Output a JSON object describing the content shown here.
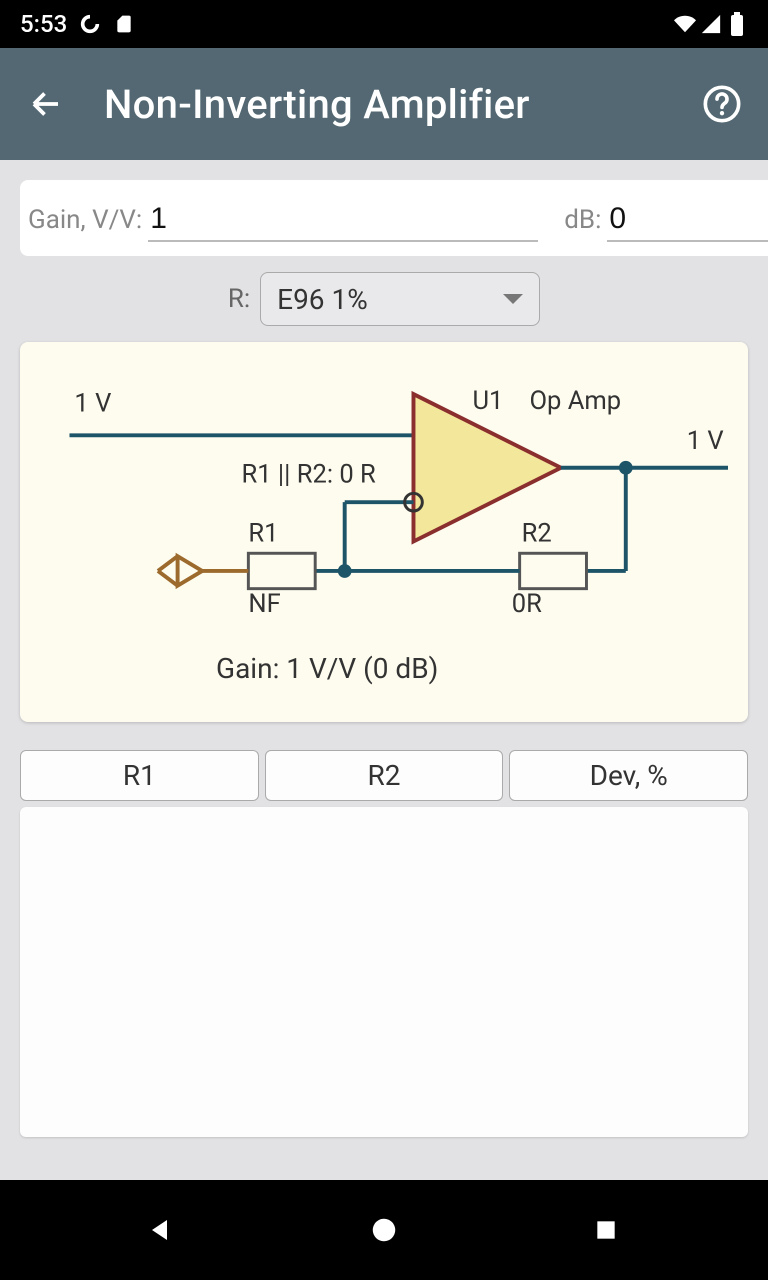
{
  "status": {
    "time": "5:53"
  },
  "header": {
    "title": "Non-Inverting Amplifier"
  },
  "inputs": {
    "gain_label": "Gain, V/V:",
    "gain_value": "1",
    "db_label": "dB:",
    "db_value": "0"
  },
  "series": {
    "label": "R:",
    "selected": "E96 1%"
  },
  "schematic": {
    "vin": "1 V",
    "vout": "1 V",
    "u1": "U1",
    "u1_type": "Op Amp",
    "parallel": "R1 || R2: 0 R",
    "r1": "R1",
    "r1_val": "NF",
    "r2": "R2",
    "r2_val": "0R",
    "gain_result": "Gain: 1 V/V (0 dB)"
  },
  "table": {
    "col1": "R1",
    "col2": "R2",
    "col3": "Dev, %"
  }
}
